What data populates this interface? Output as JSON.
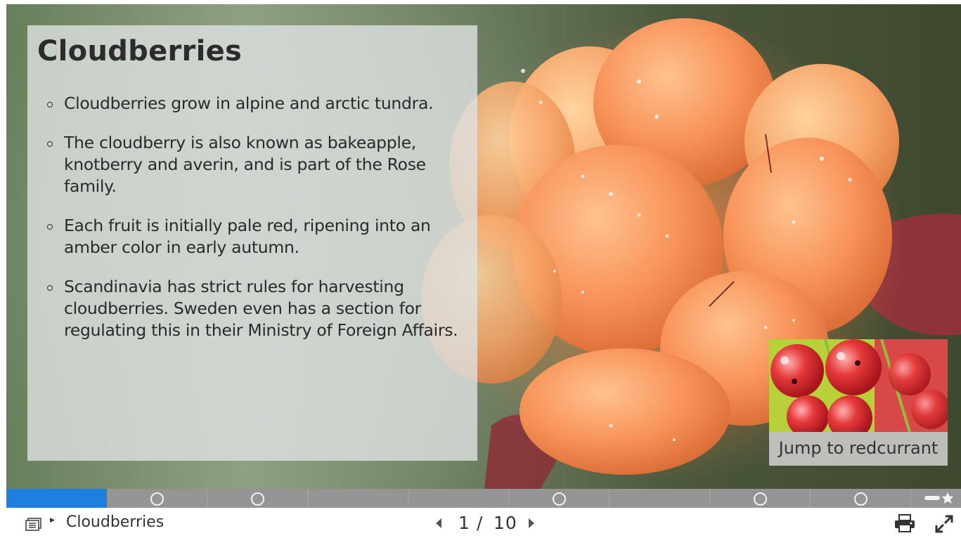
{
  "slide": {
    "title": "Cloudberries",
    "bullets": [
      "Cloudberries grow in alpine and arctic tundra.",
      "The cloudberry is also known as bakeapple, knotberry and averin, and is part of the Rose family.",
      "Each fruit is initially pale red, ripening into an amber color in early autumn.",
      "Scandinavia has strict rules for harvesting cloudberries. Sweden even has a section for regulating this in their Ministry of Foreign Affairs."
    ],
    "background_icon": "cloudberry-photo",
    "jump_card": {
      "label": "Jump to redcurrant",
      "image_icon": "redcurrant-photo"
    }
  },
  "progress": {
    "segments": [
      {
        "slide": 1,
        "active": true,
        "marker": null
      },
      {
        "slide": 2,
        "active": false,
        "marker": "circle"
      },
      {
        "slide": 3,
        "active": false,
        "marker": "circle"
      },
      {
        "slide": 4,
        "active": false,
        "marker": null
      },
      {
        "slide": 5,
        "active": false,
        "marker": null
      },
      {
        "slide": 6,
        "active": false,
        "marker": "circle"
      },
      {
        "slide": 7,
        "active": false,
        "marker": null
      },
      {
        "slide": 8,
        "active": false,
        "marker": "circle"
      },
      {
        "slide": 9,
        "active": false,
        "marker": "circle"
      },
      {
        "slide": 10,
        "active": false,
        "marker": "star"
      }
    ]
  },
  "footer": {
    "menu_icon": "slide-list-icon",
    "current_title": "Cloudberries",
    "current_page": "1",
    "separator": "/",
    "total_pages": "10",
    "prev_icon": "prev-arrow-icon",
    "next_icon": "next-arrow-icon",
    "print_icon": "print-icon",
    "fullscreen_icon": "fullscreen-icon"
  },
  "colors": {
    "progress_active": "#1f7fde",
    "progress_bg": "#959595",
    "panel_bg": "#dee2e2",
    "berry_orange": "#f39a5a"
  }
}
